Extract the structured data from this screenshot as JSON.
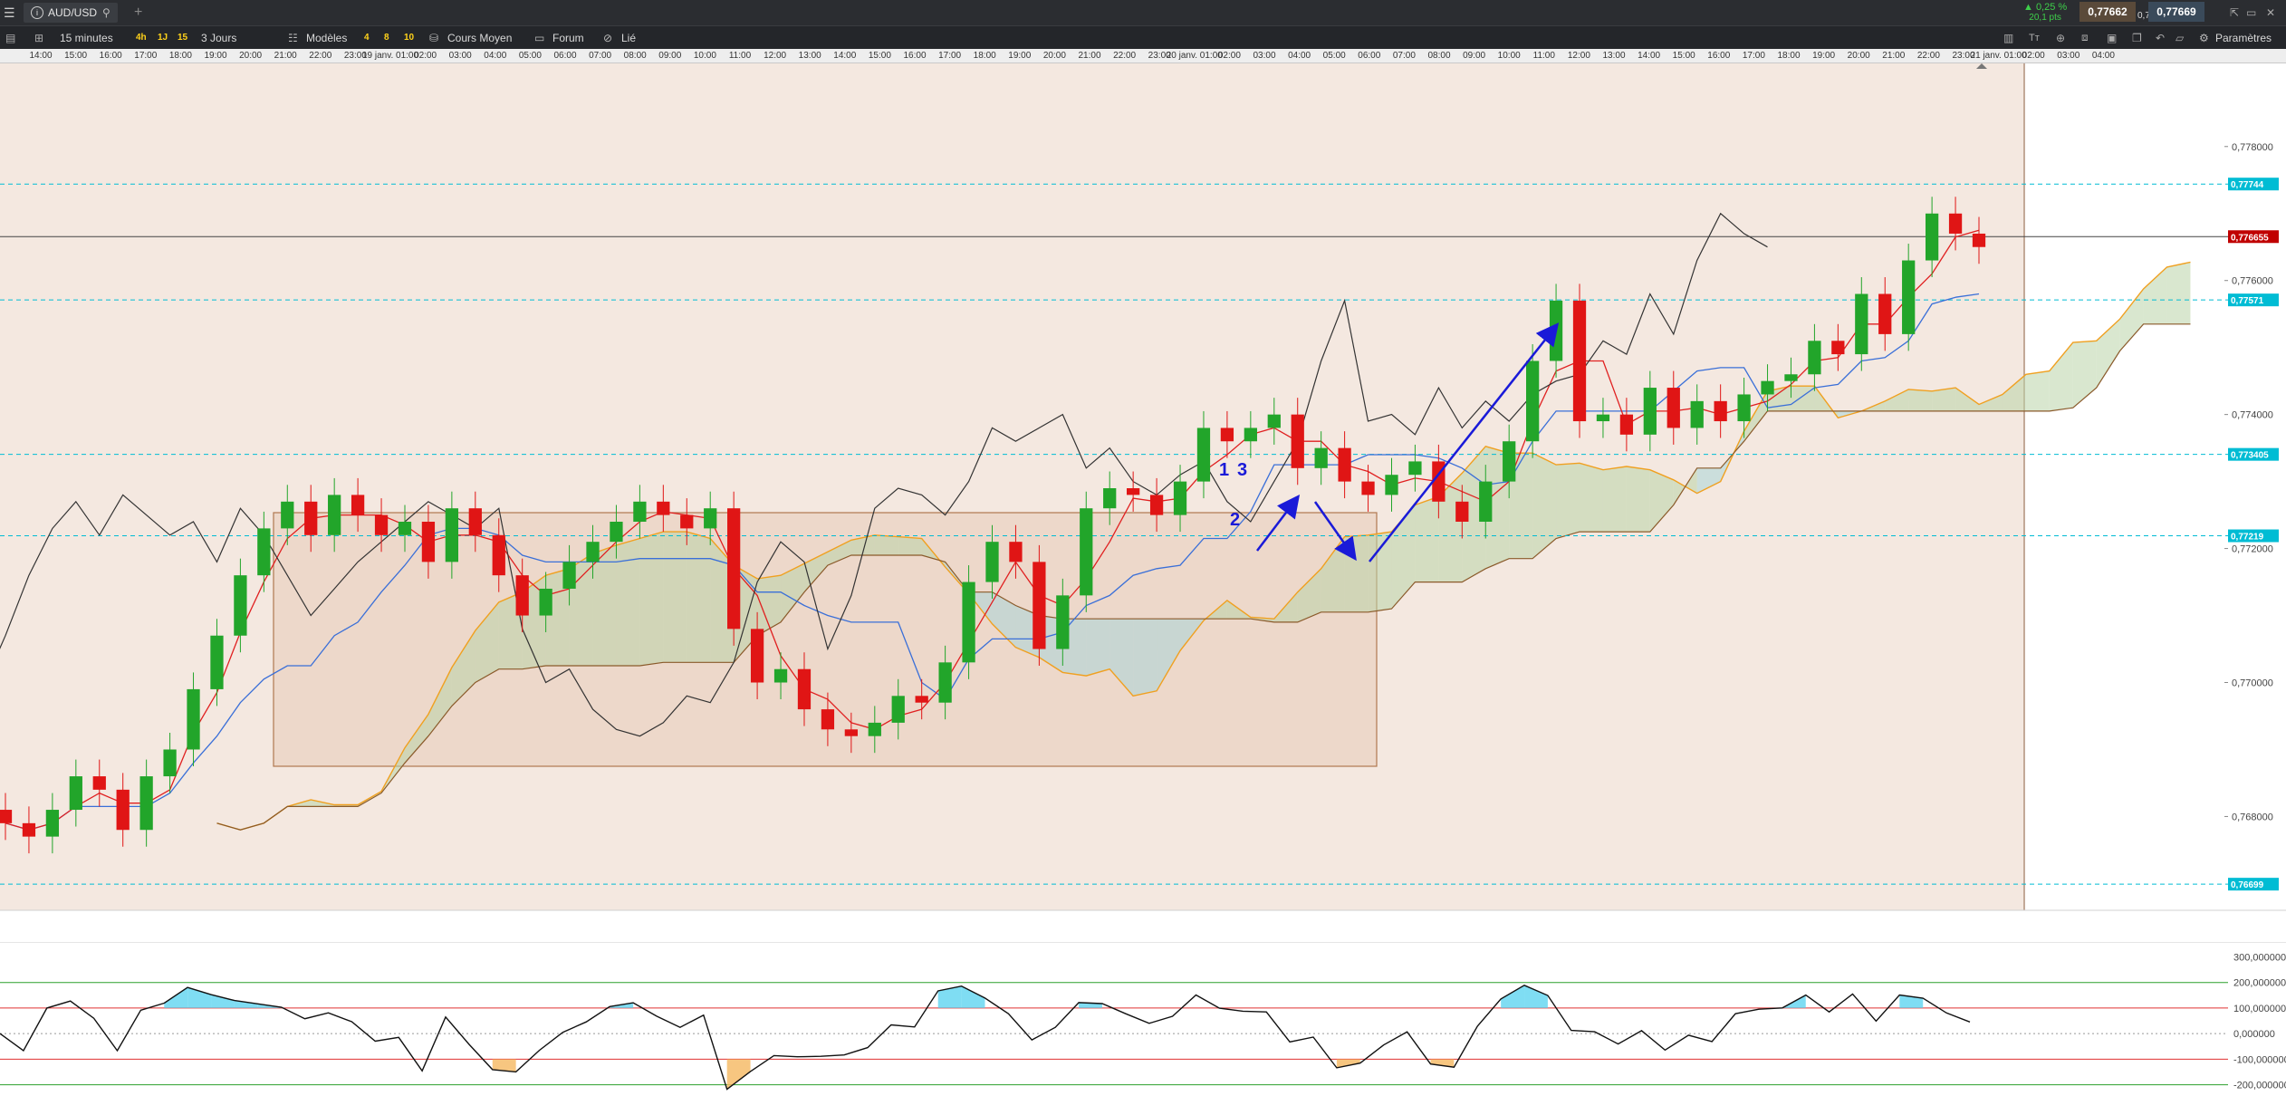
{
  "titlebar": {
    "symbol": "AUD/USD",
    "change_pct": "▲ 0,25 %",
    "change_pts": "20,1 pts",
    "bid": "0,77662",
    "spread": "0,7",
    "ask": "0,77669"
  },
  "toolbar": {
    "timeframe": "15 minutes",
    "tf_shortcuts": [
      "4h",
      "1J",
      "15"
    ],
    "period": "3 Jours",
    "models_label": "Modèles",
    "model_shortcuts": [
      "4",
      "8",
      "10"
    ],
    "indicator_label": "Cours Moyen",
    "forum_label": "Forum",
    "link_label": "Lié",
    "settings_label": "Paramètres"
  },
  "time_axis": [
    "14:00",
    "15:00",
    "16:00",
    "17:00",
    "18:00",
    "19:00",
    "20:00",
    "21:00",
    "22:00",
    "23:00",
    "19 janv. 01:00",
    "02:00",
    "03:00",
    "04:00",
    "05:00",
    "06:00",
    "07:00",
    "08:00",
    "09:00",
    "10:00",
    "11:00",
    "12:00",
    "13:00",
    "14:00",
    "15:00",
    "16:00",
    "17:00",
    "18:00",
    "19:00",
    "20:00",
    "21:00",
    "22:00",
    "23:00",
    "20 janv. 01:00",
    "02:00",
    "03:00",
    "04:00",
    "05:00",
    "06:00",
    "07:00",
    "08:00",
    "09:00",
    "10:00",
    "11:00",
    "12:00",
    "13:00",
    "14:00",
    "15:00",
    "16:00",
    "17:00",
    "18:00",
    "19:00",
    "20:00",
    "21:00",
    "22:00",
    "23:00",
    "21 janv. 01:00",
    "02:00",
    "03:00",
    "04:00"
  ],
  "chart_data": {
    "type": "candlestick",
    "instrument": "AUD/USD",
    "ylim": [
      0.7666,
      0.7787
    ],
    "y_ticks": [
      "0,778000",
      "0,776000",
      "0,774000",
      "0,772000",
      "0,770000",
      "0,768000"
    ],
    "horizontal_levels": [
      {
        "value": 0.77744,
        "label": "0,77744",
        "color": "#00bcd4"
      },
      {
        "value": 0.776655,
        "label": "0,776655",
        "color": "#c00000"
      },
      {
        "value": 0.77571,
        "label": "0,77571",
        "color": "#00bcd4"
      },
      {
        "value": 0.773405,
        "label": "0,773405",
        "color": "#00bcd4"
      },
      {
        "value": 0.77219,
        "label": "0,77219",
        "color": "#00bcd4"
      },
      {
        "value": 0.76699,
        "label": "0,76699",
        "color": "#00bcd4"
      }
    ],
    "annotations": [
      "1",
      "3",
      "2"
    ],
    "close_approx": [
      0.7679,
      0.7677,
      0.7681,
      0.7686,
      0.7684,
      0.7678,
      0.7686,
      0.769,
      0.7699,
      0.7707,
      0.7716,
      0.7723,
      0.7727,
      0.7722,
      0.7728,
      0.7725,
      0.7722,
      0.7724,
      0.7718,
      0.7726,
      0.7722,
      0.7716,
      0.771,
      0.7714,
      0.7718,
      0.7721,
      0.7724,
      0.7727,
      0.7725,
      0.7723,
      0.7726,
      0.7708,
      0.77,
      0.7702,
      0.7696,
      0.7693,
      0.7692,
      0.7694,
      0.7698,
      0.7697,
      0.7703,
      0.7715,
      0.7721,
      0.7718,
      0.7705,
      0.7713,
      0.7726,
      0.7729,
      0.7728,
      0.7725,
      0.773,
      0.7738,
      0.7736,
      0.7738,
      0.774,
      0.7732,
      0.7735,
      0.773,
      0.7728,
      0.7731,
      0.7733,
      0.7727,
      0.7724,
      0.773,
      0.7736,
      0.7748,
      0.7757,
      0.7739,
      0.774,
      0.7737,
      0.7744,
      0.7738,
      0.7742,
      0.7739,
      0.7743,
      0.7745,
      0.7746,
      0.7751,
      0.7749,
      0.7758,
      0.7752,
      0.7763,
      0.777,
      0.7767,
      0.7765
    ],
    "oscillator": {
      "y_ticks": [
        "300,000000",
        "200,000000",
        "100,000000",
        "0,000000",
        "-100,000000",
        "-200,000000"
      ],
      "ylim": [
        -290,
        330
      ],
      "levels": [
        200,
        100,
        -100,
        -200
      ]
    }
  }
}
